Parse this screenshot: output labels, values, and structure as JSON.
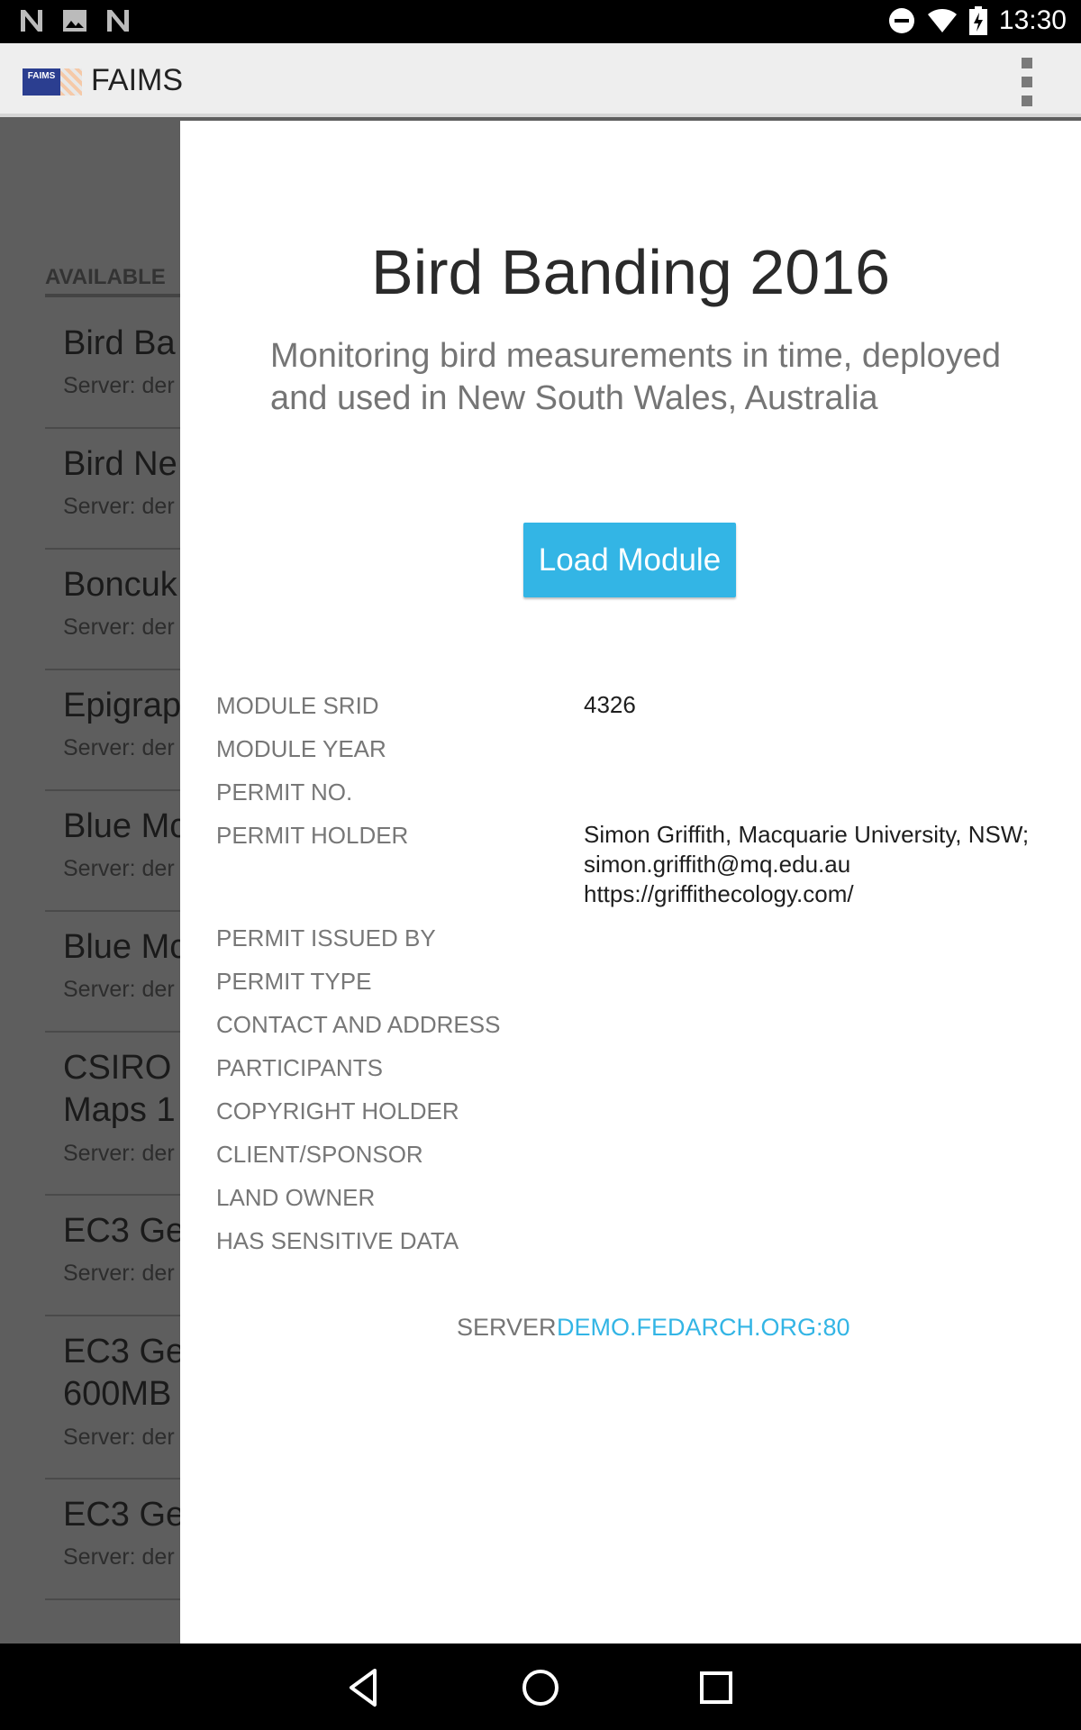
{
  "status_bar": {
    "time": "13:30",
    "left_icons": [
      "n-notification-icon",
      "image-notification-icon",
      "n-notification-icon"
    ],
    "right_icons": [
      "do-not-disturb-icon",
      "wifi-icon",
      "battery-charging-icon"
    ]
  },
  "app_bar": {
    "title": "FAIMS",
    "logo_text": "FAIMS",
    "overflow_icon": "more-vert-icon"
  },
  "background_list": {
    "section_header": "AVAILABLE",
    "items": [
      {
        "title": "Bird Ba",
        "subtitle": "Server: der"
      },
      {
        "title": "Bird Ne",
        "subtitle": "Server: der"
      },
      {
        "title": "Boncuk",
        "subtitle": "Server: der"
      },
      {
        "title": "Epigrap",
        "subtitle": "Server: der"
      },
      {
        "title": "Blue Mc",
        "subtitle": "Server: der"
      },
      {
        "title": "Blue Mc",
        "subtitle": "Server: der"
      },
      {
        "title": "CSIRO C\nMaps 1",
        "subtitle": "Server: der"
      },
      {
        "title": "EC3 Ge",
        "subtitle": "Server: der"
      },
      {
        "title": "EC3 Ge\n600MB",
        "subtitle": "Server: der"
      },
      {
        "title": "EC3 Ge",
        "subtitle": "Server: der"
      }
    ]
  },
  "module": {
    "title": "Bird Banding 2016",
    "description": "Monitoring bird measurements in time, deployed and used in New South Wales, Australia",
    "load_button": "Load Module",
    "fields": [
      {
        "label": "MODULE SRID",
        "value": "4326"
      },
      {
        "label": "MODULE YEAR",
        "value": ""
      },
      {
        "label": "PERMIT NO.",
        "value": ""
      },
      {
        "label": "PERMIT HOLDER",
        "value": "Simon Griffith, Macquarie University, NSW; simon.griffith@mq.edu.au https://griffithecology.com/"
      },
      {
        "label": "PERMIT ISSUED BY",
        "value": ""
      },
      {
        "label": "PERMIT TYPE",
        "value": ""
      },
      {
        "label": "CONTACT AND ADDRESS",
        "value": ""
      },
      {
        "label": "PARTICIPANTS",
        "value": ""
      },
      {
        "label": "COPYRIGHT HOLDER",
        "value": ""
      },
      {
        "label": "CLIENT/SPONSOR",
        "value": ""
      },
      {
        "label": "LAND OWNER",
        "value": ""
      },
      {
        "label": "HAS SENSITIVE DATA",
        "value": ""
      }
    ],
    "server_label": "SERVER",
    "server_value": "DEMO.FEDARCH.ORG:80"
  },
  "nav_bar": {
    "icons": [
      "back-icon",
      "home-icon",
      "recents-icon"
    ]
  },
  "colors": {
    "accent": "#33b5e5",
    "scrim": "#5e5e5e",
    "appbar": "#eeeeee"
  }
}
